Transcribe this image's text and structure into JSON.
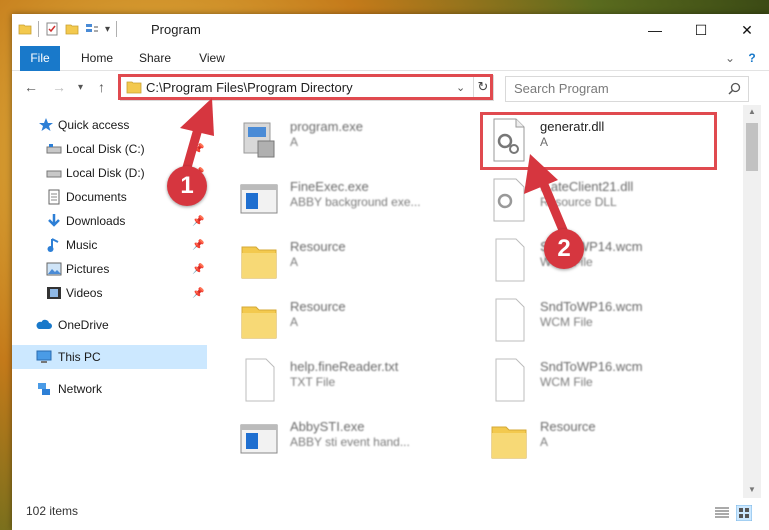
{
  "window": {
    "title": "Program",
    "min_label": "—",
    "max_label": "☐",
    "close_label": "✕"
  },
  "ribbon": {
    "tabs": [
      "File",
      "Home",
      "Share",
      "View"
    ],
    "help_glyph": "?",
    "expand_glyph": "⌄"
  },
  "address": {
    "path": "C:\\Program Files\\Program Directory"
  },
  "search": {
    "placeholder": "Search Program"
  },
  "sidebar": {
    "items": [
      {
        "label": "Quick access",
        "icon": "star-icon"
      },
      {
        "label": "Local Disk (C:)",
        "icon": "drive-icon"
      },
      {
        "label": "Local Disk (D:)",
        "icon": "drive-icon"
      },
      {
        "label": "Documents",
        "icon": "documents-icon"
      },
      {
        "label": "Downloads",
        "icon": "download-icon"
      },
      {
        "label": "Music",
        "icon": "music-icon"
      },
      {
        "label": "Pictures",
        "icon": "pictures-icon"
      },
      {
        "label": "Videos",
        "icon": "videos-icon"
      },
      {
        "label": "OneDrive",
        "icon": "cloud-icon"
      },
      {
        "label": "This PC",
        "icon": "pc-icon"
      },
      {
        "label": "Network",
        "icon": "network-icon"
      }
    ]
  },
  "files": [
    {
      "name": "program.exe",
      "sub": "A",
      "icon": "installer-icon"
    },
    {
      "name": "generatr.dll",
      "sub": "A",
      "icon": "dll-icon"
    },
    {
      "name": "FineExec.exe",
      "sub": "ABBY background exe...",
      "icon": "window-exe-icon"
    },
    {
      "name": "...ateClient21.dll",
      "sub": "Resource DLL",
      "icon": "dll-icon"
    },
    {
      "name": "Resource",
      "sub": "A",
      "icon": "folder-icon"
    },
    {
      "name": "SndToWP14.wcm",
      "sub": "WCM File",
      "icon": "blank-file-icon"
    },
    {
      "name": "Resource",
      "sub": "A",
      "icon": "folder-icon"
    },
    {
      "name": "SndToWP16.wcm",
      "sub": "WCM File",
      "icon": "blank-file-icon"
    },
    {
      "name": "help.fineReader.txt",
      "sub": "TXT File",
      "icon": "blank-file-icon"
    },
    {
      "name": "SndToWP16.wcm",
      "sub": "WCM File",
      "icon": "blank-file-icon"
    },
    {
      "name": "AbbySTI.exe",
      "sub": "ABBY sti event hand...",
      "icon": "window-exe-icon"
    },
    {
      "name": "Resource",
      "sub": "A",
      "icon": "folder-icon"
    }
  ],
  "status": {
    "count": "102 items"
  },
  "callouts": [
    "1",
    "2"
  ],
  "colors": {
    "accent": "#1979ca",
    "highlight": "#e04a4f",
    "callout": "#d6363f",
    "selected": "#cce8ff"
  }
}
